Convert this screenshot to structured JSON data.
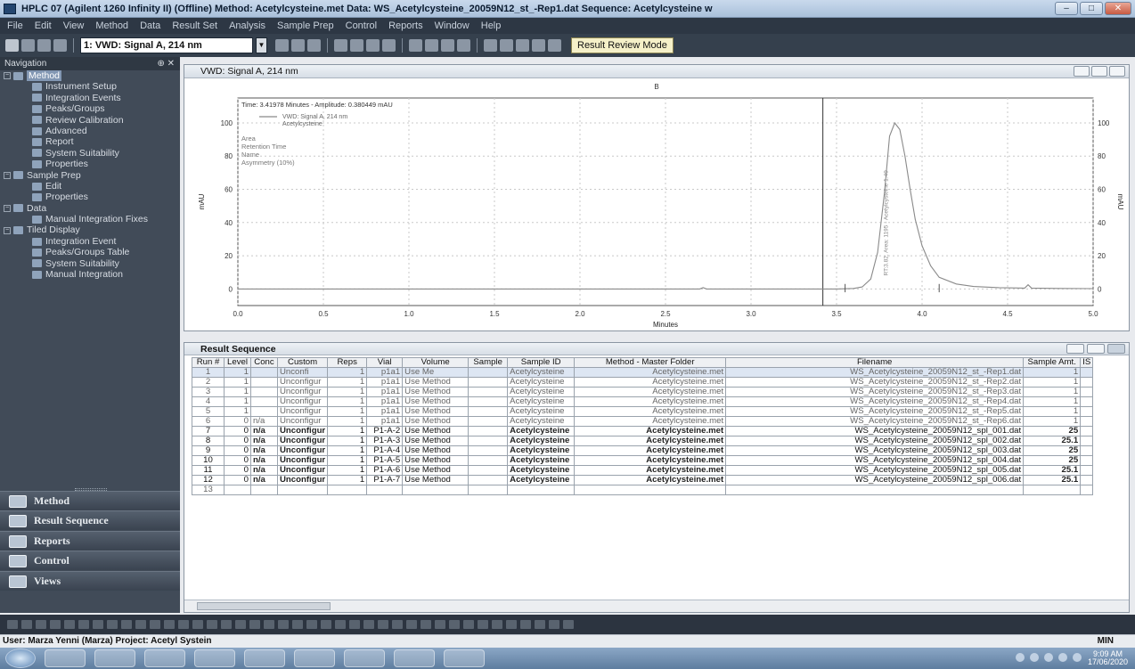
{
  "window": {
    "title": "HPLC 07 (Agilent 1260 Infinity II) (Offline)    Method: Acetylcysteine.met    Data: WS_Acetylcysteine_20059N12_st_-Rep1.dat    Sequence: Acetylcysteine w",
    "controls": [
      "–",
      "□",
      "✕"
    ]
  },
  "menu": [
    "File",
    "Edit",
    "View",
    "Method",
    "Data",
    "Result Set",
    "Analysis",
    "Sample Prep",
    "Control",
    "Reports",
    "Window",
    "Help"
  ],
  "toolbar": {
    "signal_select": "1: VWD: Signal A, 214 nm",
    "mode_label": "Result Review Mode"
  },
  "navigation": {
    "header": "Navigation",
    "header_ctrl": "⊕ ✕",
    "items": [
      {
        "label": "Method",
        "icon": "method-icon",
        "level": 0,
        "expander": "−",
        "selected": true
      },
      {
        "label": "Instrument Setup",
        "icon": "instrument-icon",
        "level": 2
      },
      {
        "label": "Integration Events",
        "icon": "integration-icon",
        "level": 2
      },
      {
        "label": "Peaks/Groups",
        "icon": "peaks-icon",
        "level": 2
      },
      {
        "label": "Review Calibration",
        "icon": "calibration-icon",
        "level": 2
      },
      {
        "label": "Advanced",
        "icon": "advanced-icon",
        "level": 2
      },
      {
        "label": "Report",
        "icon": "report-icon",
        "level": 2
      },
      {
        "label": "System Suitability",
        "icon": "suitability-icon",
        "level": 2
      },
      {
        "label": "Properties",
        "icon": "properties-icon",
        "level": 2
      },
      {
        "label": "Sample Prep",
        "icon": "sample-prep-icon",
        "level": 0,
        "expander": "−"
      },
      {
        "label": "Edit",
        "icon": "edit-icon",
        "level": 2
      },
      {
        "label": "Properties",
        "icon": "properties-icon",
        "level": 2
      },
      {
        "label": "Data",
        "icon": "data-icon",
        "level": 0,
        "expander": "−"
      },
      {
        "label": "Manual Integration Fixes",
        "icon": "manual-fix-icon",
        "level": 2
      },
      {
        "label": "Tiled Display",
        "icon": "tiled-icon",
        "level": 0,
        "expander": "−"
      },
      {
        "label": "Integration Event",
        "icon": "integration-icon",
        "level": 2
      },
      {
        "label": "Peaks/Groups Table",
        "icon": "table-icon",
        "level": 2
      },
      {
        "label": "System Suitability",
        "icon": "suitability-icon",
        "level": 2
      },
      {
        "label": "Manual Integration",
        "icon": "manual-icon",
        "level": 2
      }
    ],
    "bottom_buttons": [
      "Method",
      "Result Sequence",
      "Reports",
      "Control",
      "Views"
    ]
  },
  "chart_window": {
    "title": "VWD: Signal A, 214 nm",
    "top_marker": "B"
  },
  "chart_data": {
    "type": "line",
    "title": "",
    "xlabel": "Minutes",
    "ylabel": "mAU",
    "xlim": [
      0,
      5
    ],
    "ylim": [
      -10,
      115
    ],
    "x_ticks": [
      "0.0",
      "0.5",
      "1.0",
      "1.5",
      "2.0",
      "2.5",
      "3.0",
      "3.5",
      "4.0",
      "4.5",
      "5.0"
    ],
    "y_ticks": [
      "0",
      "20",
      "40",
      "60",
      "80",
      "100"
    ],
    "cursor_readout": "Time: 3.41978 Minutes - Amplitude: 0.380449 mAU",
    "cursor_x": 3.42,
    "legend": [
      "VWD: Signal A, 214 nm",
      "Acetylcysteine"
    ],
    "info_lines": [
      "Area",
      "Retention Time",
      "Name",
      "Asymmetry (10%)"
    ],
    "peak_label": "RT:3.82, Area: 1195 - Acetylcysteine 1.49",
    "series": [
      {
        "name": "VWD: Signal A, 214 nm",
        "x": [
          0,
          0.5,
          1.0,
          1.5,
          2.0,
          2.5,
          2.7,
          2.72,
          2.74,
          3.0,
          3.4,
          3.5,
          3.6,
          3.65,
          3.7,
          3.74,
          3.78,
          3.81,
          3.84,
          3.87,
          3.9,
          3.93,
          3.96,
          4.0,
          4.05,
          4.1,
          4.2,
          4.3,
          4.45,
          4.6,
          4.62,
          4.64,
          4.8,
          5.0
        ],
        "y": [
          0,
          0,
          0,
          0,
          0,
          0,
          0,
          0.8,
          0,
          0,
          0,
          0,
          0.3,
          1.2,
          6,
          22,
          58,
          92,
          100,
          96,
          80,
          60,
          42,
          26,
          14,
          7,
          3,
          1.5,
          0.8,
          0.5,
          2.5,
          0.5,
          0.3,
          0.2
        ]
      }
    ]
  },
  "sequence": {
    "title": "Result Sequence",
    "columns": [
      "Run #",
      "Level",
      "Conc",
      "Custom",
      "Reps",
      "Vial",
      "Volume",
      "Sample",
      "Sample ID",
      "Method - Master Folder",
      "Filename",
      "Sample Amt.",
      "IS"
    ],
    "rows": [
      {
        "run": "1",
        "level": "1",
        "conc": "",
        "custom": "Unconfi",
        "reps": "1",
        "vial": "p1a1",
        "volume": "Use Me",
        "sample": "",
        "sample_id": "Acetylcysteine",
        "method": "Acetylcysteine.met",
        "filename": "WS_Acetylcysteine_20059N12_st_-Rep1.dat",
        "amt": "1",
        "is": "",
        "first": true
      },
      {
        "run": "2",
        "level": "1",
        "conc": "",
        "custom": "Unconfigur",
        "reps": "1",
        "vial": "p1a1",
        "volume": "Use Method",
        "sample": "",
        "sample_id": "Acetylcysteine",
        "method": "Acetylcysteine.met",
        "filename": "WS_Acetylcysteine_20059N12_st_-Rep2.dat",
        "amt": "1",
        "is": ""
      },
      {
        "run": "3",
        "level": "1",
        "conc": "",
        "custom": "Unconfigur",
        "reps": "1",
        "vial": "p1a1",
        "volume": "Use Method",
        "sample": "",
        "sample_id": "Acetylcysteine",
        "method": "Acetylcysteine.met",
        "filename": "WS_Acetylcysteine_20059N12_st_-Rep3.dat",
        "amt": "1",
        "is": ""
      },
      {
        "run": "4",
        "level": "1",
        "conc": "",
        "custom": "Unconfigur",
        "reps": "1",
        "vial": "p1a1",
        "volume": "Use Method",
        "sample": "",
        "sample_id": "Acetylcysteine",
        "method": "Acetylcysteine.met",
        "filename": "WS_Acetylcysteine_20059N12_st_-Rep4.dat",
        "amt": "1",
        "is": ""
      },
      {
        "run": "5",
        "level": "1",
        "conc": "",
        "custom": "Unconfigur",
        "reps": "1",
        "vial": "p1a1",
        "volume": "Use Method",
        "sample": "",
        "sample_id": "Acetylcysteine",
        "method": "Acetylcysteine.met",
        "filename": "WS_Acetylcysteine_20059N12_st_-Rep5.dat",
        "amt": "1",
        "is": ""
      },
      {
        "run": "6",
        "level": "0",
        "conc": "n/a",
        "custom": "Unconfigur",
        "reps": "1",
        "vial": "p1a1",
        "volume": "Use Method",
        "sample": "",
        "sample_id": "Acetylcysteine",
        "method": "Acetylcysteine.met",
        "filename": "WS_Acetylcysteine_20059N12_st_-Rep6.dat",
        "amt": "1",
        "is": ""
      },
      {
        "run": "7",
        "level": "0",
        "conc": "n/a",
        "custom": "Unconfigur",
        "reps": "1",
        "vial": "P1-A-2",
        "volume": "Use Method",
        "sample": "",
        "sample_id": "Acetylcysteine",
        "method": "Acetylcysteine.met",
        "filename": "WS_Acetylcysteine_20059N12_spl_001.dat",
        "amt": "25",
        "is": "",
        "bold": true
      },
      {
        "run": "8",
        "level": "0",
        "conc": "n/a",
        "custom": "Unconfigur",
        "reps": "1",
        "vial": "P1-A-3",
        "volume": "Use Method",
        "sample": "",
        "sample_id": "Acetylcysteine",
        "method": "Acetylcysteine.met",
        "filename": "WS_Acetylcysteine_20059N12_spl_002.dat",
        "amt": "25.1",
        "is": "",
        "bold": true
      },
      {
        "run": "9",
        "level": "0",
        "conc": "n/a",
        "custom": "Unconfigur",
        "reps": "1",
        "vial": "P1-A-4",
        "volume": "Use Method",
        "sample": "",
        "sample_id": "Acetylcysteine",
        "method": "Acetylcysteine.met",
        "filename": "WS_Acetylcysteine_20059N12_spl_003.dat",
        "amt": "25",
        "is": "",
        "bold": true
      },
      {
        "run": "10",
        "level": "0",
        "conc": "n/a",
        "custom": "Unconfigur",
        "reps": "1",
        "vial": "P1-A-5",
        "volume": "Use Method",
        "sample": "",
        "sample_id": "Acetylcysteine",
        "method": "Acetylcysteine.met",
        "filename": "WS_Acetylcysteine_20059N12_spl_004.dat",
        "amt": "25",
        "is": "",
        "bold": true
      },
      {
        "run": "11",
        "level": "0",
        "conc": "n/a",
        "custom": "Unconfigur",
        "reps": "1",
        "vial": "P1-A-6",
        "volume": "Use Method",
        "sample": "",
        "sample_id": "Acetylcysteine",
        "method": "Acetylcysteine.met",
        "filename": "WS_Acetylcysteine_20059N12_spl_005.dat",
        "amt": "25.1",
        "is": "",
        "bold": true
      },
      {
        "run": "12",
        "level": "0",
        "conc": "n/a",
        "custom": "Unconfigur",
        "reps": "1",
        "vial": "P1-A-7",
        "volume": "Use Method",
        "sample": "",
        "sample_id": "Acetylcysteine",
        "method": "Acetylcysteine.met",
        "filename": "WS_Acetylcysteine_20059N12_spl_006.dat",
        "amt": "25.1",
        "is": "",
        "bold": true
      },
      {
        "run": "13",
        "level": "",
        "conc": "",
        "custom": "",
        "reps": "",
        "vial": "",
        "volume": "",
        "sample": "",
        "sample_id": "",
        "method": "",
        "filename": "",
        "amt": "",
        "is": ""
      }
    ]
  },
  "status": {
    "user": "User: Marza Yenni (Marza)  Project: Acetyl Systein",
    "mode": "MIN"
  },
  "taskbar": {
    "time": "9:09 AM",
    "date": "17/06/2020"
  }
}
